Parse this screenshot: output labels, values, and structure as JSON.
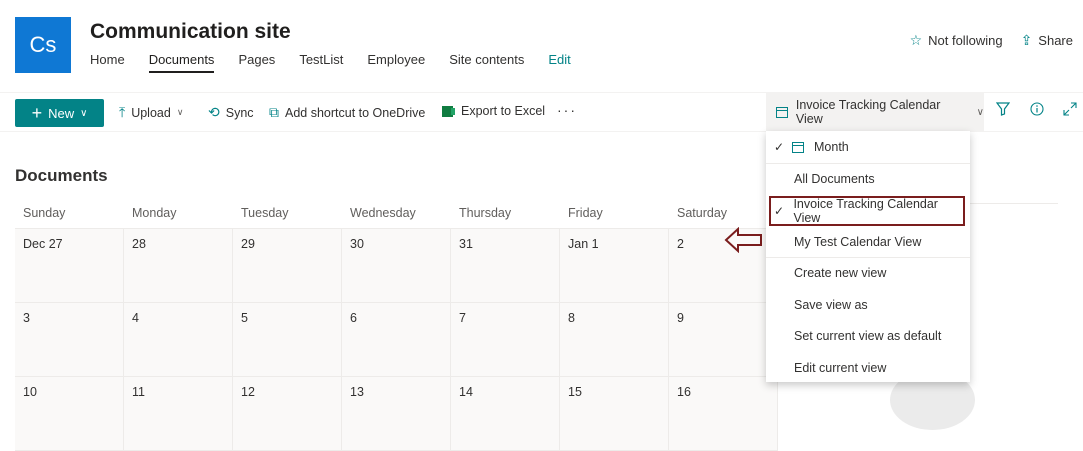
{
  "site": {
    "logo_text": "Cs",
    "title": "Communication site",
    "nav": [
      "Home",
      "Documents",
      "Pages",
      "TestList",
      "Employee",
      "Site contents",
      "Edit"
    ],
    "active_nav": "Documents"
  },
  "header_actions": {
    "follow_label": "Not following",
    "share_label": "Share"
  },
  "commandbar": {
    "new_label": "New",
    "upload_label": "Upload",
    "sync_label": "Sync",
    "shortcut_label": "Add shortcut to OneDrive",
    "excel_label": "Export to Excel",
    "more_label": "···",
    "current_view": "Invoice Tracking Calendar View"
  },
  "library": {
    "title": "Documents",
    "weekdays": [
      "Sunday",
      "Monday",
      "Tuesday",
      "Wednesday",
      "Thursday",
      "Friday",
      "Saturday"
    ],
    "weeks": [
      [
        "Dec 27",
        "28",
        "29",
        "30",
        "31",
        "Jan 1",
        "2"
      ],
      [
        "3",
        "4",
        "5",
        "6",
        "7",
        "8",
        "9"
      ],
      [
        "10",
        "11",
        "12",
        "13",
        "14",
        "15",
        "16"
      ]
    ]
  },
  "view_menu": {
    "month_label": "Month",
    "all_documents": "All Documents",
    "invoice_view": "Invoice Tracking Calendar View",
    "my_test_view": "My Test Calendar View",
    "create_new": "Create new view",
    "save_as": "Save view as",
    "set_default": "Set current view as default",
    "edit_current": "Edit current view"
  },
  "colors": {
    "accent": "#038387",
    "logo_bg": "#0f78d4",
    "annotation": "#7a1d1d"
  }
}
